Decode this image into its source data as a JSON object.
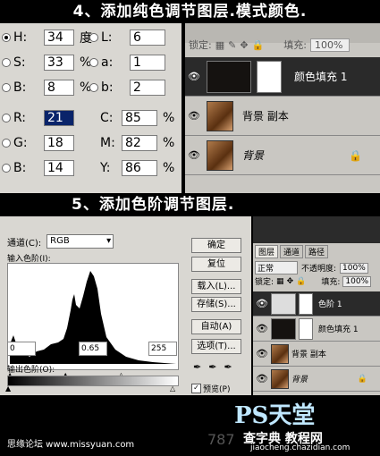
{
  "banner_top": "4、添加纯色调节图层.模式颜色.",
  "banner_mid": "5、添加色阶调节图层.",
  "color_picker": {
    "h": {
      "label": "H:",
      "value": "34",
      "unit": "度"
    },
    "s": {
      "label": "S:",
      "value": "33",
      "unit": "%"
    },
    "b": {
      "label": "B:",
      "value": "8",
      "unit": "%"
    },
    "r": {
      "label": "R:",
      "value": "21"
    },
    "g": {
      "label": "G:",
      "value": "18"
    },
    "bb": {
      "label": "B:",
      "value": "14"
    },
    "l": {
      "label": "L:",
      "value": "6"
    },
    "a": {
      "label": "a:",
      "value": "1"
    },
    "b2": {
      "label": "b:",
      "value": "2"
    },
    "c": {
      "label": "C:",
      "value": "85",
      "unit": "%"
    },
    "m": {
      "label": "M:",
      "value": "82",
      "unit": "%"
    },
    "y": {
      "label": "Y:",
      "value": "86",
      "unit": "%"
    }
  },
  "layers_top": {
    "lock_label": "锁定:",
    "fill_label": "填充:",
    "fill_value": "100%",
    "layers": [
      "颜色填充 1",
      "背景 副本",
      "背景"
    ]
  },
  "levels": {
    "channel_label": "通道(C):",
    "channel_value": "RGB",
    "input_label": "输入色阶(I):",
    "input_black": "0",
    "input_gamma": "0.65",
    "input_white": "255",
    "output_label": "输出色阶(O):",
    "buttons": [
      "确定",
      "复位",
      "载入(L)...",
      "存储(S)...",
      "自动(A)",
      "选项(T)..."
    ],
    "preview_label": "预览(P)"
  },
  "layers_bottom": {
    "tabs": [
      "图层",
      "通道",
      "路径"
    ],
    "mode": "正常",
    "opacity_label": "不透明度:",
    "opacity_value": "100%",
    "lock_label": "锁定:",
    "fill_label": "填充:",
    "fill_value": "100%",
    "layers": [
      "色阶 1",
      "颜色填充 1",
      "背景 副本",
      "背景"
    ]
  },
  "footer": {
    "left_text": "思缘论坛 www.missyuan.com",
    "logo_text": "PS天堂",
    "num_text": "787",
    "site_text": "查字典 教程网",
    "site_url": "jiaocheng.chazidian.com"
  }
}
